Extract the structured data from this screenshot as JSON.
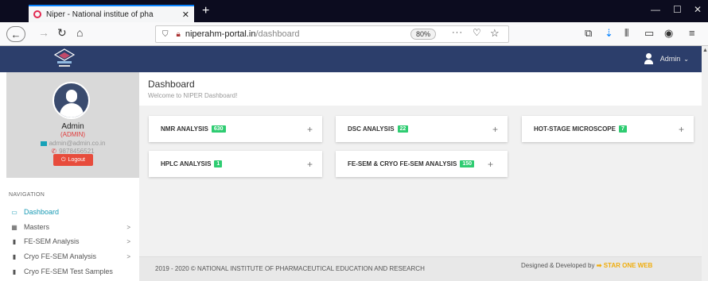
{
  "browser": {
    "tab_title": "Niper - National institue of pha",
    "url_host": "niperahm-portal.in",
    "url_path": "/dashboard",
    "zoom": "80%"
  },
  "header": {
    "user_label": "Admin"
  },
  "profile": {
    "name": "Admin",
    "role": "(ADMIN)",
    "email": "admin@admin.co.in",
    "phone": "9878456521",
    "logout_label": "Logout"
  },
  "sidebar": {
    "heading": "NAVIGATION",
    "items": [
      {
        "label": "Dashboard",
        "icon": "monitor-icon",
        "active": true,
        "has_chevron": false
      },
      {
        "label": "Masters",
        "icon": "grid-icon",
        "active": false,
        "has_chevron": true
      },
      {
        "label": "FE-SEM Analysis",
        "icon": "flask-icon",
        "active": false,
        "has_chevron": true
      },
      {
        "label": "Cryo FE-SEM Analysis",
        "icon": "flask-icon",
        "active": false,
        "has_chevron": true
      },
      {
        "label": "Cryo FE-SEM Test Samples",
        "icon": "flask-icon",
        "active": false,
        "has_chevron": false
      }
    ]
  },
  "page": {
    "title": "Dashboard",
    "subtitle": "Welcome to NIPER Dashboard!"
  },
  "cards": [
    {
      "label": "NMR ANALYSIS",
      "count": "630"
    },
    {
      "label": "DSC ANALYSIS",
      "count": "22"
    },
    {
      "label": "HOT-STAGE MICROSCOPE",
      "count": "7"
    },
    {
      "label": "HPLC ANALYSIS",
      "count": "1"
    },
    {
      "label": "FE-SEM & CRYO FE-SEM ANALYSIS",
      "count": "150"
    }
  ],
  "footer": {
    "copyright": "2019 - 2020 © NATIONAL INSTITUTE OF PHARMACEUTICAL EDUCATION AND RESEARCH",
    "credit_prefix": "Designed & Developed by",
    "credit_brand": "STAR ONE WEB"
  },
  "colors": {
    "header_bg": "#2c3e6b",
    "accent": "#1a9bb5",
    "badge": "#2ecc71",
    "logout": "#e74c3c"
  }
}
